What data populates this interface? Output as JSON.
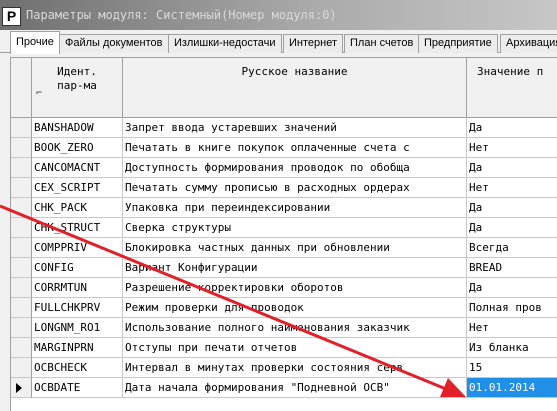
{
  "window": {
    "icon_text": "Р",
    "title": "Параметры модуля: Системный(Номер модуля:0)"
  },
  "tabs": [
    "Прочие",
    "Файлы документов",
    "Излишки-недостачи",
    "Интернет",
    "План счетов",
    "Предприятие",
    "Архивация"
  ],
  "grid": {
    "headers": {
      "id": "Идент.",
      "id_line2": "пар-ма",
      "ru": "Русское название",
      "val": "Значение п"
    },
    "rows": [
      {
        "id": "BANSHADOW",
        "ru": "Запрет ввода устаревших значений",
        "val": "Да"
      },
      {
        "id": "BOOK_ZERO",
        "ru": "Печатать в книге покупок оплаченные счета с",
        "val": "Нет"
      },
      {
        "id": "CANCOMACNT",
        "ru": "Доступность формирования проводок по обобща",
        "val": "Да"
      },
      {
        "id": "CEX_SCRIPT",
        "ru": "Печатать сумму прописью в расходных ордерах",
        "val": "Нет"
      },
      {
        "id": "CHK_PACK",
        "ru": "Упаковка при переиндексировании",
        "val": "Да"
      },
      {
        "id": "CHK_STRUCT",
        "ru": "Сверка структуры",
        "val": "Да"
      },
      {
        "id": "COMPPRIV",
        "ru": "Блокировка частных данных при обновлении",
        "val": "Всегда"
      },
      {
        "id": "CONFIG",
        "ru": "Вариант Конфигурации",
        "val": "BREAD"
      },
      {
        "id": "CORRMTUN",
        "ru": "Разрешение корректировки оборотов",
        "val": "Да"
      },
      {
        "id": "FULLCHKPRV",
        "ru": "Режим проверки для проводок",
        "val": "Полная пров"
      },
      {
        "id": "LONGNM_RO1",
        "ru": "Использование полного наименования заказчик",
        "val": "Нет"
      },
      {
        "id": "MARGINPRN",
        "ru": "Отступы при печати отчетов",
        "val": "Из бланка"
      },
      {
        "id": "OCBCHECK",
        "ru": "Интервал в минутах проверки состояния серв",
        "val": "15"
      },
      {
        "id": "OCBDATE",
        "ru": "Дата начала формирования \"Подневной ОСВ\"",
        "val": "01.01.2014"
      }
    ]
  },
  "colors": {
    "selection": "#1f8fe8",
    "annotation_arrow": "#e2202a"
  }
}
